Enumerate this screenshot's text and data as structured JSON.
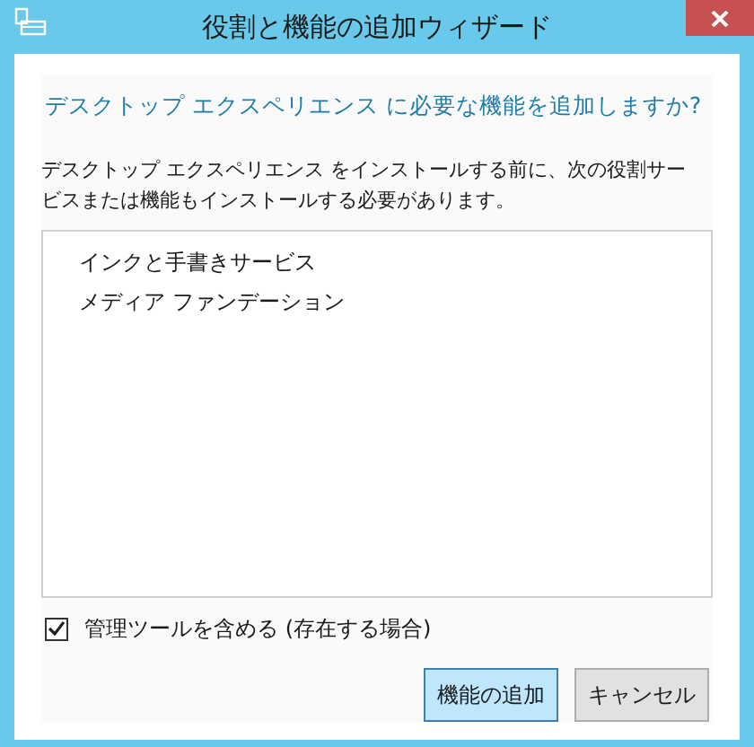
{
  "window": {
    "title": "役割と機能の追加ウィザード"
  },
  "heading": "デスクトップ エクスペリエンス に必要な機能を追加しますか?",
  "description": "デスクトップ エクスペリエンス をインストールする前に、次の役割サービスまたは機能もインストールする必要があります。",
  "features": [
    {
      "label": "インクと手書きサービス"
    },
    {
      "label": "メディア ファンデーション"
    }
  ],
  "include_tools": {
    "label": "管理ツールを含める (存在する場合)",
    "checked": true
  },
  "buttons": [
    {
      "label": "機能の追加",
      "kind": "primary"
    },
    {
      "label": "キャンセル",
      "kind": "secondary"
    }
  ]
}
